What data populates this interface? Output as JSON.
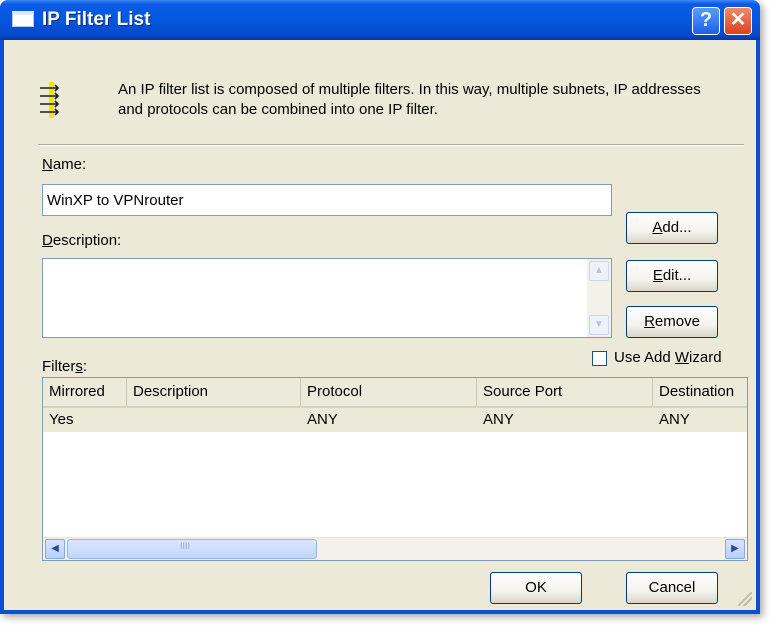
{
  "window": {
    "title": "IP Filter List",
    "help_label": "?",
    "close_label": "✕"
  },
  "info": {
    "text": "An IP filter list is composed of multiple filters. In this way, multiple subnets, IP addresses and protocols can be combined into one IP filter.",
    "icon": "filter-list-icon"
  },
  "name_field": {
    "label_accel": "N",
    "label_rest": "ame:",
    "value": "WinXP to VPNrouter"
  },
  "description_field": {
    "label_accel": "D",
    "label_rest": "escription:",
    "value": ""
  },
  "buttons": {
    "add": {
      "accel": "A",
      "rest": "dd..."
    },
    "edit": {
      "accel": "E",
      "rest": "dit..."
    },
    "remove": {
      "accel": "R",
      "rest": "emove"
    },
    "ok": "OK",
    "cancel": "Cancel"
  },
  "filters": {
    "label_pre": "Filter",
    "label_accel": "s",
    "label_post": ":",
    "use_wizard": {
      "pre": "Use Add ",
      "accel": "W",
      "post": "izard",
      "checked": false
    },
    "columns": [
      "Mirrored",
      "Description",
      "Protocol",
      "Source Port",
      "Destination"
    ],
    "rows": [
      {
        "mirrored": "Yes",
        "description": "",
        "protocol": "ANY",
        "source_port": "ANY",
        "destination": "ANY"
      }
    ],
    "hscroll_thumb_grip": "IIII"
  },
  "colors": {
    "titlebar": "#0a5ae6",
    "dialog_bg": "#ece9d8",
    "selected_row": "#ece9d8",
    "border_blue": "#7f9db9"
  }
}
